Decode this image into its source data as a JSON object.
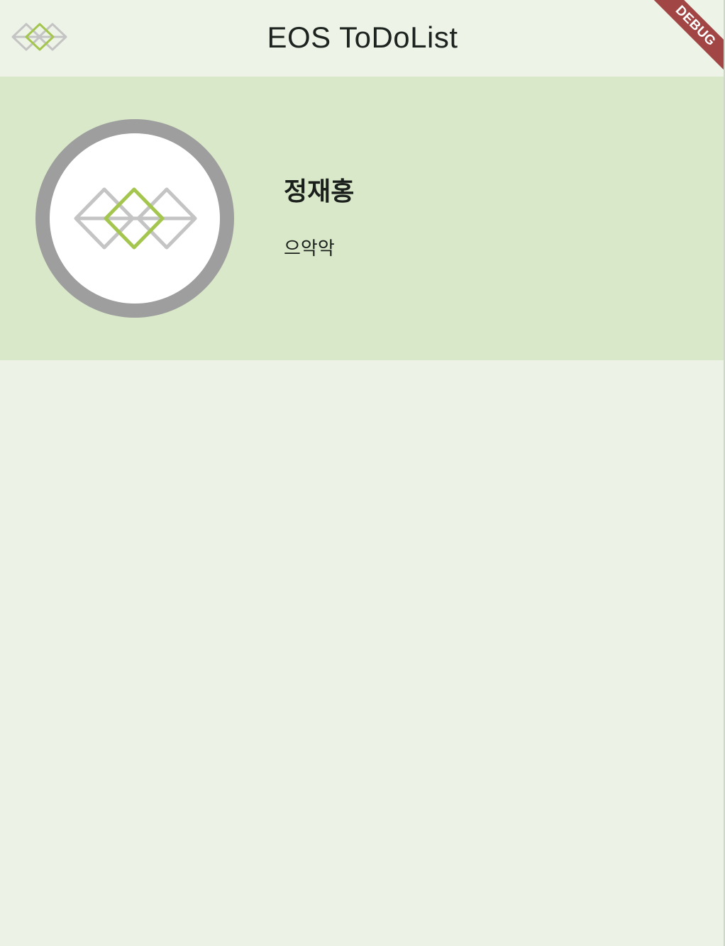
{
  "app_bar": {
    "title": "EOS ToDoList",
    "logo_icon": "eos-diamond-logo-icon"
  },
  "profile": {
    "name": "정재홍",
    "status": "으악악",
    "avatar_icon": "eos-diamond-logo-icon"
  },
  "debug_banner": {
    "label": "DEBUG"
  },
  "colors": {
    "app_bar_bg": "#EDF3E7",
    "page_bg": "#ECF3E6",
    "profile_panel_bg": "#D9E8C8",
    "avatar_ring": "#9E9E9E",
    "logo_gray": "#C4C4C4",
    "logo_green": "#A4C64F",
    "debug_banner": "#A14545"
  }
}
